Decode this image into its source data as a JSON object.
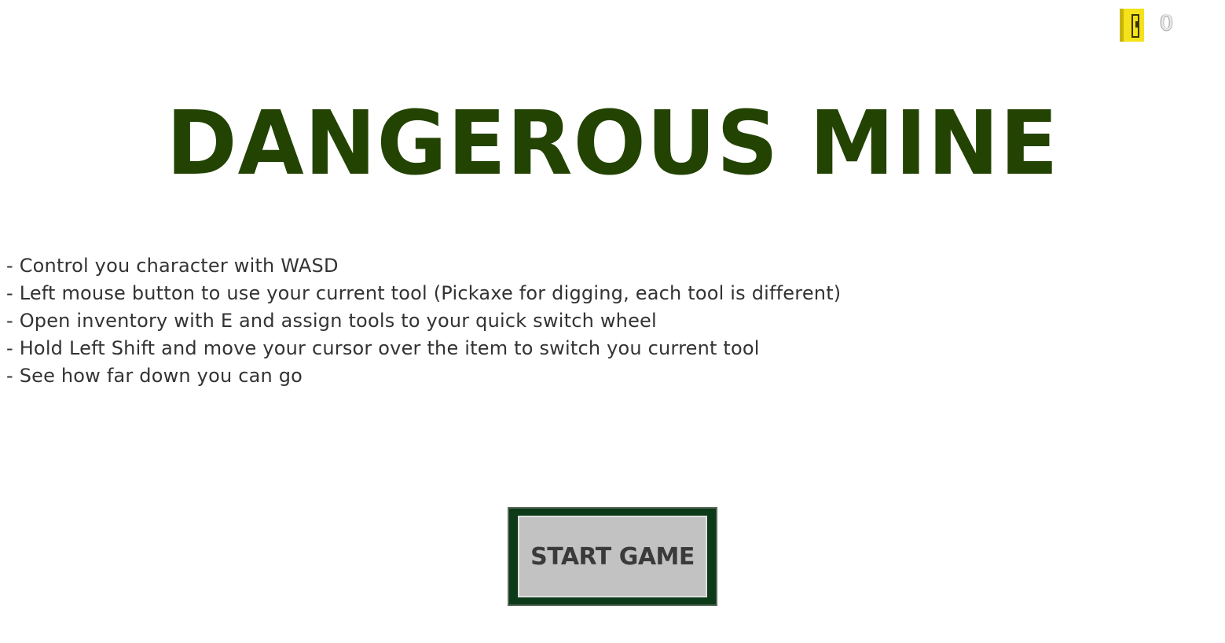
{
  "hud": {
    "coin_icon": "coin-icon",
    "coin_count": "0",
    "coin_color": "#f4e21a"
  },
  "title": "DANGEROUS MINE",
  "title_color": "#234303",
  "instructions": [
    "- Control you character with WASD",
    "- Left mouse button to use your current tool (Pickaxe for digging, each tool is different)",
    "- Open inventory with E and assign tools to your quick switch wheel",
    "- Hold Left Shift and move your cursor over the item to switch you current tool",
    "- See how far down you can go"
  ],
  "start_button": {
    "label": "START GAME",
    "frame_color": "#0d3a18",
    "face_color": "#c2c2c2"
  }
}
